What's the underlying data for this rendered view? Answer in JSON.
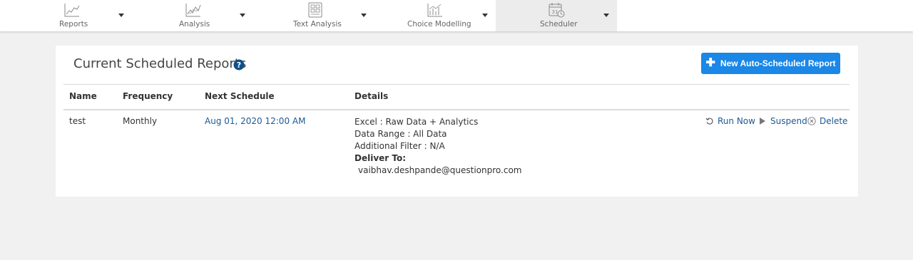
{
  "nav": {
    "tabs": [
      {
        "label": "Reports",
        "icon": "line-chart-icon"
      },
      {
        "label": "Analysis",
        "icon": "analysis-chart-icon"
      },
      {
        "label": "Text Analysis",
        "icon": "text-analysis-icon"
      },
      {
        "label": "Choice Modelling",
        "icon": "choice-chart-icon"
      },
      {
        "label": "Scheduler",
        "icon": "calendar-clock-icon",
        "active": true
      }
    ],
    "calendar_day": "31"
  },
  "card": {
    "title": "Current Scheduled Reports",
    "new_button_label": "New Auto-Scheduled Report"
  },
  "table": {
    "headers": [
      "Name",
      "Frequency",
      "Next Schedule",
      "Details"
    ],
    "rows": [
      {
        "name": "test",
        "frequency": "Monthly",
        "next_schedule": "Aug 01, 2020 12:00 AM",
        "details": {
          "export": "Excel : Raw Data + Analytics",
          "data_range": "Data Range : All Data",
          "filter": "Additional Filter : N/A",
          "deliver_label": "Deliver To:",
          "deliver_email": "vaibhav.deshpande@questionpro.com"
        },
        "actions": {
          "run_now": "Run Now",
          "suspend": "Suspend",
          "delete": "Delete"
        }
      }
    ]
  },
  "colors": {
    "accent": "#1b87e6",
    "link": "#1a5a96",
    "background": "#f1f1f1"
  }
}
